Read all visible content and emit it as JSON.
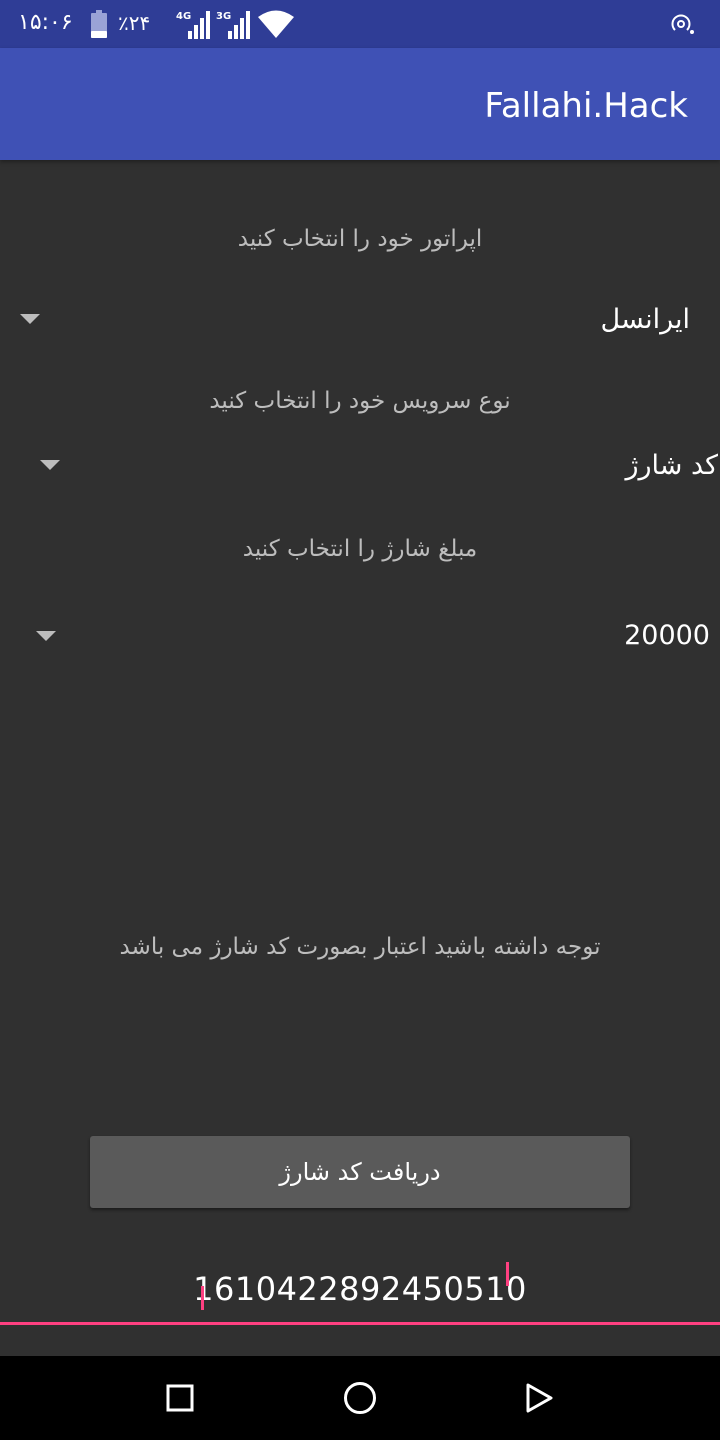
{
  "status_bar": {
    "time": "۱۵:۰۶",
    "battery_percent": "٪۲۴",
    "battery_level": 0.24,
    "network_1": "4G",
    "network_2": "3G"
  },
  "app_bar": {
    "title": "Fallahi.Hack"
  },
  "operator": {
    "label": "اپراتور خود را انتخاب کنید",
    "selected": "ایرانسل"
  },
  "service": {
    "label": "نوع سرویس خود را انتخاب کنید",
    "selected": "کد شارژ"
  },
  "amount": {
    "label": "مبلغ شارژ را انتخاب کنید",
    "selected": "20000"
  },
  "notice": "توجه داشته باشید اعتبار بصورت کد شارژ می باشد",
  "submit_button": "دریافت کد شارژ",
  "charge_code": "1610422892450510",
  "colors": {
    "status_bar": "#2f3d96",
    "app_bar": "#3f51b5",
    "background": "#303030",
    "accent": "#ff4081",
    "button": "#5a5a5a"
  },
  "icons": [
    "battery-icon",
    "signal-icon",
    "wifi-icon",
    "hotspot-icon",
    "recents-icon",
    "home-icon",
    "back-icon"
  ]
}
